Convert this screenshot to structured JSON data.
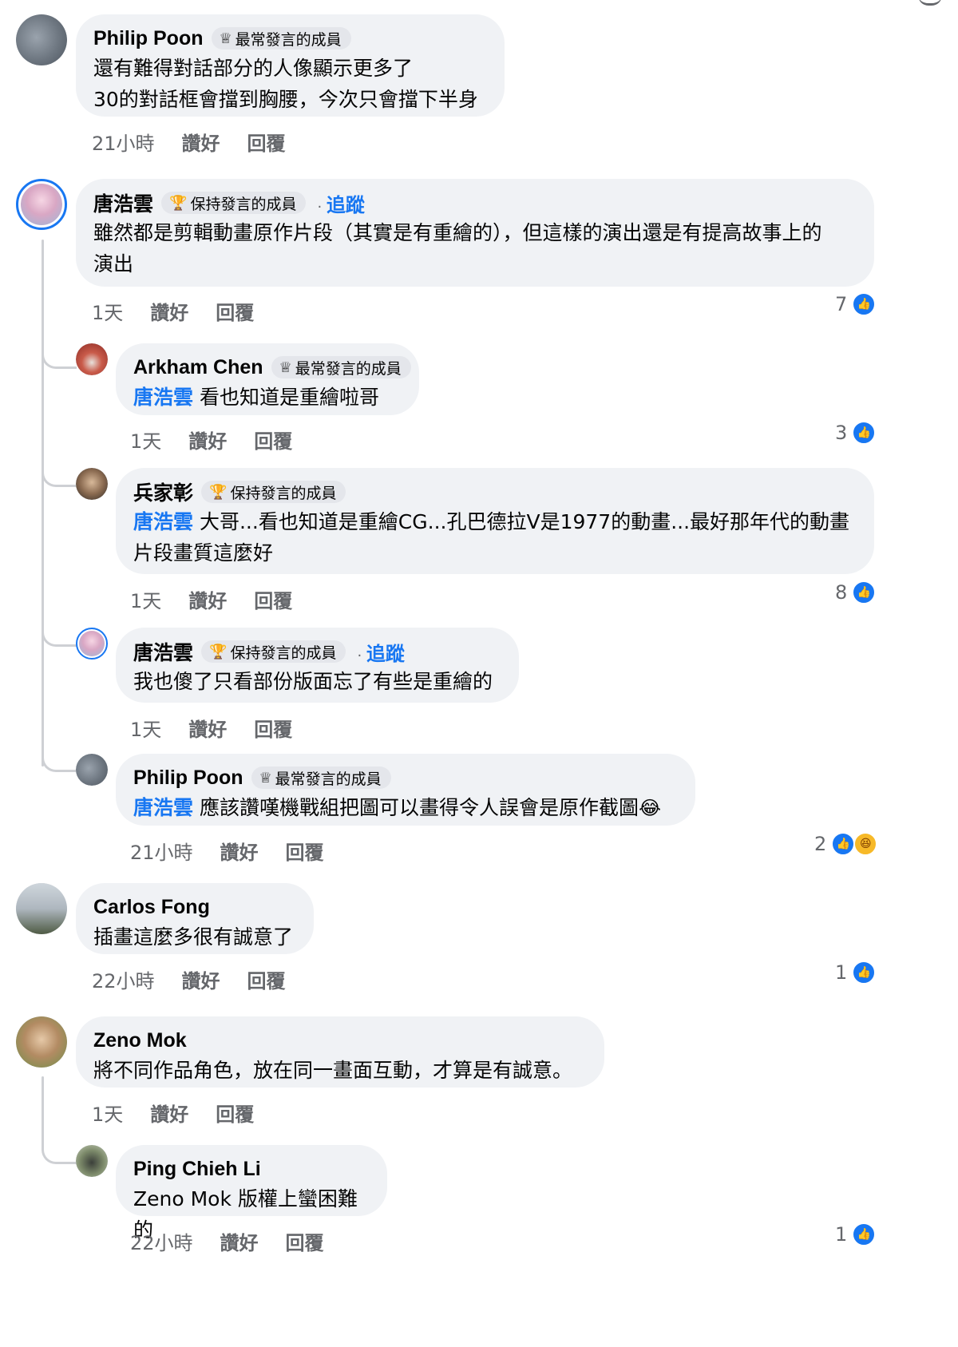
{
  "ui": {
    "like_label": "讚好",
    "reply_label": "回覆",
    "follow_label": "追蹤",
    "badge_top": "最常發言的成員",
    "badge_steady": "保持發言的成員",
    "colors": {
      "accent": "#1877f2",
      "bubble": "#f0f2f5",
      "meta": "#65676b"
    }
  },
  "comments": [
    {
      "name": "Philip Poon",
      "badge": "最常發言的成員",
      "badge_icon": "top-contributor-icon",
      "lines": [
        "還有難得對話部分的人像顯示更多了",
        "30的對話框會擋到胸腰，今次只會擋下半身"
      ],
      "time": "21小時"
    },
    {
      "name": "唐浩雲",
      "badge": "保持發言的成員",
      "badge_icon": "trophy-icon",
      "follow": "追蹤",
      "lines": [
        "雖然都是剪輯動畫原作片段（其實是有重繪的），但這樣的演出還是有提高故事上的",
        "演出"
      ],
      "time": "1天",
      "reactions": "7"
    },
    {
      "name": "Arkham Chen",
      "badge": "最常發言的成員",
      "badge_icon": "top-contributor-icon",
      "mention": "唐浩雲",
      "text": "看也知道是重繪啦哥",
      "time": "1天",
      "reactions": "3"
    },
    {
      "name": "兵家彰",
      "badge": "保持發言的成員",
      "badge_icon": "trophy-icon",
      "mention": "唐浩雲",
      "text": "大哥...看也知道是重繪CG...孔巴德拉V是1977的動畫...最好那年代的動畫",
      "text2": "片段畫質這麼好",
      "time": "1天",
      "reactions": "8"
    },
    {
      "name": "唐浩雲",
      "badge": "保持發言的成員",
      "badge_icon": "trophy-icon",
      "follow": "追蹤",
      "text": "我也傻了只看部份版面忘了有些是重繪的",
      "time": "1天"
    },
    {
      "name": "Philip Poon",
      "badge": "最常發言的成員",
      "badge_icon": "top-contributor-icon",
      "mention": "唐浩雲",
      "text": "應該讚嘆機戰組把圖可以畫得令人誤會是原作截圖",
      "time": "21小時",
      "reactions": "2",
      "reaction_icons": [
        "like-icon",
        "haha-icon"
      ]
    },
    {
      "name": "Carlos Fong",
      "text": "插畫這麼多很有誠意了",
      "time": "22小時",
      "reactions": "1"
    },
    {
      "name": "Zeno Mok",
      "text": "將不同作品角色，放在同一畫面互動，才算是有誠意。",
      "time": "1天"
    },
    {
      "name": "Ping Chieh Li",
      "mention_plain": "Zeno Mok",
      "text": "版權上蠻困難的",
      "time": "22小時",
      "reactions": "1"
    }
  ]
}
